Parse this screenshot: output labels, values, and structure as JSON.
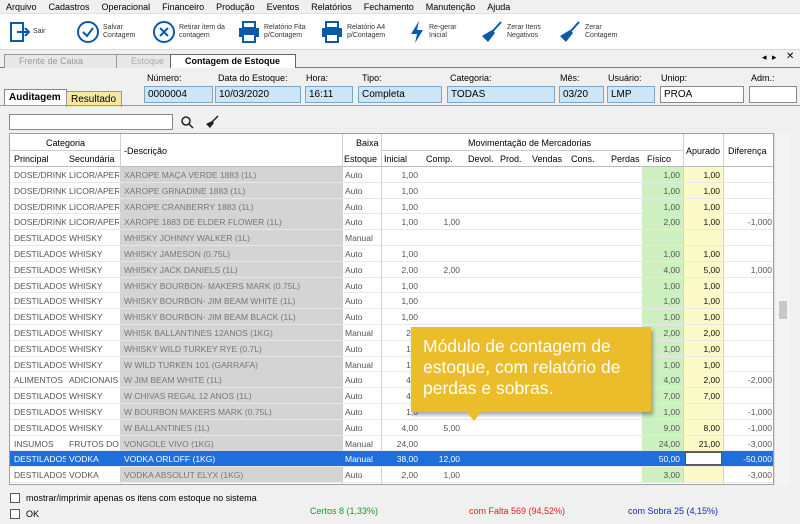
{
  "menu": [
    "Arquivo",
    "Cadastros",
    "Operacional",
    "Financeiro",
    "Produção",
    "Eventos",
    "Relatórios",
    "Fechamento",
    "Manutenção",
    "Ajuda"
  ],
  "toolbar": {
    "sair": "Sair",
    "salvar": [
      "Salvar",
      "Contagem"
    ],
    "retirar": [
      "Retirar item da",
      "contagem"
    ],
    "relfita": [
      "Relatório Fita",
      "p/Contagem"
    ],
    "rela4": [
      "Relatório A4",
      "p/Contagem"
    ],
    "regerar": [
      "Re-gerar",
      "Inicial"
    ],
    "zerarneg": [
      "Zerar Itens",
      "Negativos"
    ],
    "zerarcont": [
      "Zerar",
      "Contagem"
    ]
  },
  "tabs": [
    "Frente de Caixa",
    "Estoque",
    "Contagem de Estoque"
  ],
  "fields": {
    "numero_label": "Número:",
    "numero": "0000004",
    "data_label": "Data do Estoque:",
    "data": "10/03/2020",
    "hora_label": "Hora:",
    "hora": "16:11",
    "tipo_label": "Tipo:",
    "tipo": "Completa",
    "categoria_label": "Categoria:",
    "categoria": "TODAS",
    "mes_label": "Mês:",
    "mes": "03/20",
    "usuario_label": "Usuário:",
    "usuario": "LMP",
    "uniop_label": "Uniop:",
    "uniop": "PROA",
    "adm_label": "Adm.:",
    "adm": ""
  },
  "subtabs": [
    "Auditagem",
    "Resultado"
  ],
  "search": {
    "value": ""
  },
  "headers": {
    "categoria": "Categoria",
    "principal": "Principal",
    "secundaria": "Secundária",
    "descricao": "-Descrição",
    "baixa": "Baixa",
    "estoque": "Estoque",
    "movimentacao": "Movimentação de Mercadorias",
    "inicial": "Inicial",
    "comp": "Comp.",
    "devol": "Devol.",
    "prod": "Prod.",
    "vendas": "Vendas",
    "cons": "Cons.",
    "perdas": "Perdas",
    "fisico": "Físico",
    "apurado": "Apurado",
    "diferenca": "Diferença"
  },
  "rows": [
    {
      "p": "DOSE/DRINK",
      "s": "LICOR/APERITIVO",
      "d": "XAROPE MAÇA VERDE 1883 (1L)",
      "b": "Auto",
      "i": "1,00",
      "c": "",
      "f": "1,00",
      "a": "1,00",
      "df": ""
    },
    {
      "p": "DOSE/DRINK",
      "s": "LICOR/APERITIVO",
      "d": "XAROPE GRNADINE 1883 (1L)",
      "b": "Auto",
      "i": "1,00",
      "c": "",
      "f": "1,00",
      "a": "1,00",
      "df": ""
    },
    {
      "p": "DOSE/DRINK",
      "s": "LICOR/APERITIVO",
      "d": "XAROPE CRANBERRY 1883 (1L)",
      "b": "Auto",
      "i": "1,00",
      "c": "",
      "f": "1,00",
      "a": "1,00",
      "df": ""
    },
    {
      "p": "DOSE/DRINK",
      "s": "LICOR/APERITIVO",
      "d": "XAROPE 1883 DE ELDER FLOWER (1L)",
      "b": "Auto",
      "i": "1,00",
      "c": "1,00",
      "f": "2,00",
      "a": "1,00",
      "df": "-1,000"
    },
    {
      "p": "DESTILADOS",
      "s": "WHISKY",
      "d": "WHISKY JOHNNY WALKER (1L)",
      "b": "Manual",
      "i": "",
      "c": "",
      "f": "",
      "a": "",
      "df": ""
    },
    {
      "p": "DESTILADOS",
      "s": "WHISKY",
      "d": "WHISKY JAMESON (0.75L)",
      "b": "Auto",
      "i": "1,00",
      "c": "",
      "f": "1,00",
      "a": "1,00",
      "df": ""
    },
    {
      "p": "DESTILADOS",
      "s": "WHISKY",
      "d": "WHISKY JACK DANIELS (1L)",
      "b": "Auto",
      "i": "2,00",
      "c": "2,00",
      "f": "4,00",
      "a": "5,00",
      "df": "1,000"
    },
    {
      "p": "DESTILADOS",
      "s": "WHISKY",
      "d": "WHISKY BOURBON- MAKERS MARK (0.75L)",
      "b": "Auto",
      "i": "1,00",
      "c": "",
      "f": "1,00",
      "a": "1,00",
      "df": ""
    },
    {
      "p": "DESTILADOS",
      "s": "WHISKY",
      "d": "WHISKY BOURBON- JIM BEAM WHITE (1L)",
      "b": "Auto",
      "i": "1,00",
      "c": "",
      "f": "1,00",
      "a": "1,00",
      "df": ""
    },
    {
      "p": "DESTILADOS",
      "s": "WHISKY",
      "d": "WHISKY BOURBON- JIM BEAM BLACK (1L)",
      "b": "Auto",
      "i": "1,00",
      "c": "",
      "f": "1,00",
      "a": "1,00",
      "df": ""
    },
    {
      "p": "DESTILADOS",
      "s": "WHISKY",
      "d": "WHISK BALLANTINES 12ANOS (1KG)",
      "b": "Manual",
      "i": "2,0",
      "c": "",
      "f": "2,00",
      "a": "2,00",
      "df": ""
    },
    {
      "p": "DESTILADOS",
      "s": "WHISKY",
      "d": "WHISKY WILD TURKEY RYE (0.7L)",
      "b": "Auto",
      "i": "1,0",
      "c": "",
      "f": "1,00",
      "a": "1,00",
      "df": ""
    },
    {
      "p": "DESTILADOS",
      "s": "WHISKY",
      "d": "W WILD TURKEN 101 (GARRAFA)",
      "b": "Manual",
      "i": "1,0",
      "c": "",
      "f": "1,00",
      "a": "1,00",
      "df": ""
    },
    {
      "p": "ALIMENTOS",
      "s": "ADICIONAIS",
      "d": "W JIM BEAM WHITE (1L)",
      "b": "Auto",
      "i": "4,0",
      "c": "",
      "f": "4,00",
      "a": "2,00",
      "df": "-2,000"
    },
    {
      "p": "DESTILADOS",
      "s": "WHISKY",
      "d": "W CHIVAS REGAL 12 ANOS (1L)",
      "b": "Auto",
      "i": "4,0",
      "c": "",
      "f": "7,00",
      "a": "7,00",
      "df": ""
    },
    {
      "p": "DESTILADOS",
      "s": "WHISKY",
      "d": "W BOURBON MAKERS MARK (0.75L)",
      "b": "Auto",
      "i": "1,0",
      "c": "",
      "f": "1,00",
      "a": "",
      "df": "-1,000"
    },
    {
      "p": "DESTILADOS",
      "s": "WHISKY",
      "d": "W BALLANTINES (1L)",
      "b": "Auto",
      "i": "4,00",
      "c": "5,00",
      "f": "9,00",
      "a": "8,00",
      "df": "-1,000"
    },
    {
      "p": "INSUMOS",
      "s": "FRUTOS DO MAR",
      "d": "VONGOLE VIVO (1KG)",
      "b": "Manual",
      "i": "24,00",
      "c": "",
      "f": "24,00",
      "a": "21,00",
      "df": "-3,000"
    },
    {
      "p": "DESTILADOS",
      "s": "VODKA",
      "d": "VODKA ORLOFF (1KG)",
      "b": "Manual",
      "i": "38,00",
      "c": "12,00",
      "f": "50,00",
      "a": "",
      "df": "-50,000",
      "sel": true
    },
    {
      "p": "DESTILADOS",
      "s": "VODKA",
      "d": "VODKA ABSOLUT ELYX (1KG)",
      "b": "Auto",
      "i": "2,00",
      "c": "1,00",
      "f": "3,00",
      "a": "",
      "df": "-3,000"
    }
  ],
  "callout": "Módulo de contagem de estoque, com relatório de perdas e sobras.",
  "footer": {
    "mostrar": "mostrar/imprimir apenas os itens com estoque no sistema",
    "ok": "OK",
    "certos": "Certos 8 (1,33%)",
    "falta": "com Falta 569 (94,52%)",
    "sobra": "com Sobra 25 (4,15%)"
  },
  "colors": {
    "accent": "#1a73c7",
    "selected_row": "#1e6fd9",
    "callout": "#ecbd2a",
    "fisico_bg": "#cdf0c0",
    "apurado_bg": "#fbf9c8",
    "falta": "#e0201c",
    "sobra": "#1a2ab8",
    "certos": "#1b9a2a"
  }
}
